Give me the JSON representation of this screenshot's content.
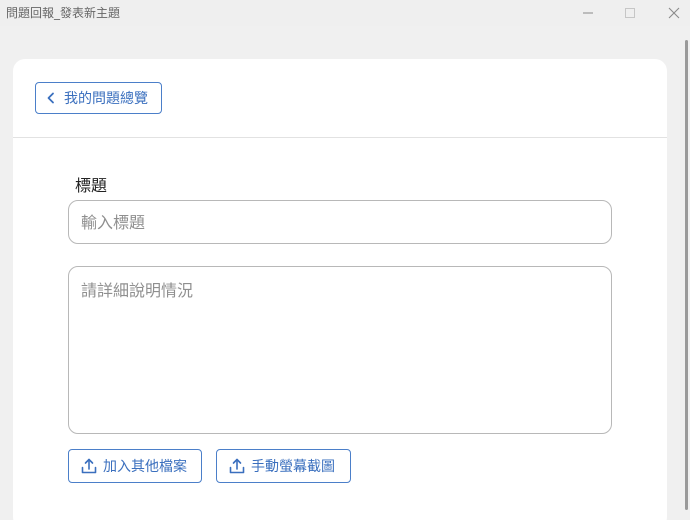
{
  "window": {
    "title": "問題回報_發表新主題",
    "controls": {
      "minimize": "minimize-icon",
      "maximize": "maximize-icon",
      "close": "close-icon"
    }
  },
  "nav": {
    "back_label": "我的問題總覽",
    "back_icon": "chevron-left-icon"
  },
  "form": {
    "title_label": "標題",
    "title_value": "",
    "title_placeholder": "輸入標題",
    "description_value": "",
    "description_placeholder": "請詳細說明情況"
  },
  "actions": {
    "attach_label": "加入其他檔案",
    "screenshot_label": "手動螢幕截圖",
    "icon": "upload-icon"
  },
  "colors": {
    "accent": "#3a6fbe",
    "border": "#b8b8b8",
    "background": "#efefef",
    "card": "#ffffff"
  }
}
